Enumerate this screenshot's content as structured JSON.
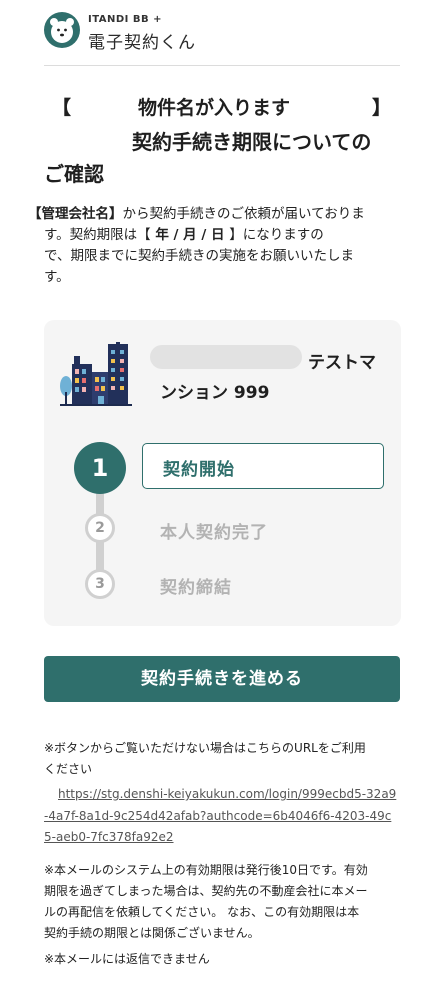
{
  "header": {
    "brand_small": "ITANDI BB +",
    "brand_name": "電子契約くん"
  },
  "title": {
    "bracket_left": "【",
    "property_placeholder": "物件名が入ります",
    "bracket_right": "】",
    "line2": "契約手続き期限についての",
    "line3": "ご確認"
  },
  "body": {
    "company": "【管理会社名】",
    "line1_rest": "から契約手続きのご依頼が届いておりま",
    "line2_prefix": "す。契約期限は【",
    "date": " 年 / 月 / 日 ",
    "line2_suffix": "】になりますの",
    "line3": "で、期限までに契約手続きの実施をお願いいたしま",
    "line4": "す。"
  },
  "card": {
    "property_name_line1": "テストマ",
    "property_name_line2": "ンション 999",
    "steps": [
      {
        "number": "1",
        "label": "契約開始",
        "active": true
      },
      {
        "number": "2",
        "label": "本人契約完了",
        "active": false
      },
      {
        "number": "3",
        "label": "契約締結",
        "active": false
      }
    ]
  },
  "cta": {
    "label": "契約手続きを進める"
  },
  "notes": {
    "button_note_line1": "※ボタンからご覧いただけない場合はこちらのURLをご利用",
    "button_note_line2": "ください",
    "url_line1": "https://stg.denshi-keiyakukun.com/login/999ecbd5-32a9",
    "url_line2": "-4a7f-8a1d-9c254d42afab?authcode=6b4046f6-4203-49c",
    "url_line3": "5-aeb0-7fc378fa92e2",
    "validity_line1": "※本メールのシステム上の有効期限は発行後10日です。有効",
    "validity_line2": "期限を過ぎてしまった場合は、契約先の不動産会社に本メー",
    "validity_line3": "ルの再配信を依頼してください。 なお、この有効期限は本",
    "validity_line4": "契約手続の期限とは関係ございません。",
    "no_reply": "※本メールには返信できません"
  },
  "colors": {
    "primary": "#2f6f6c",
    "card_bg": "#f5f5f5",
    "inactive": "#b3b3b3"
  }
}
